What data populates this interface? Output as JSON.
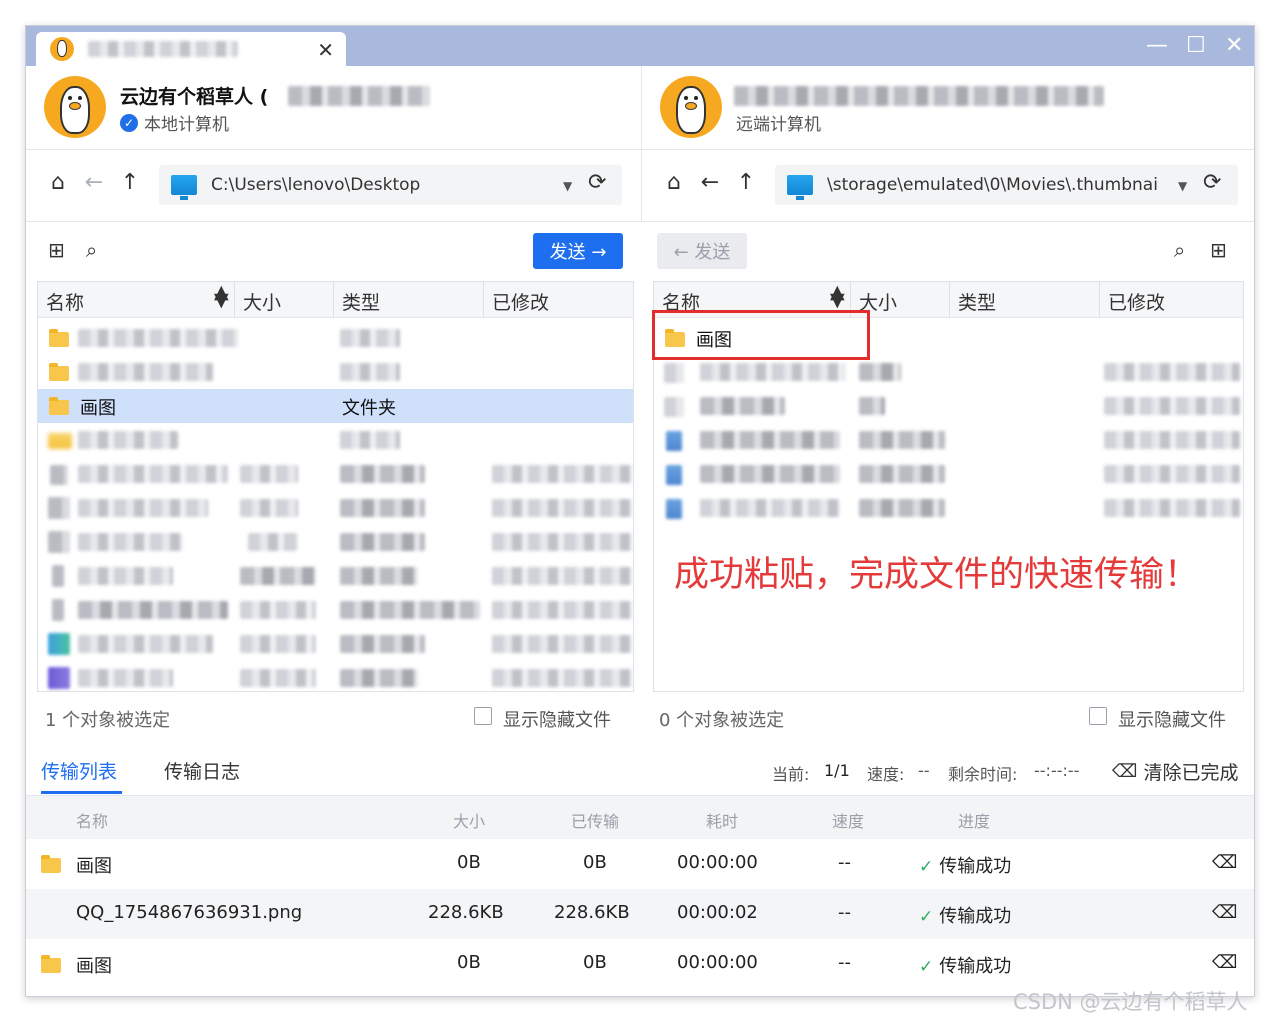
{
  "window": {
    "tab_close": "✕",
    "minimize": "—",
    "maximize": "☐",
    "close": "✕"
  },
  "local": {
    "user_name": "云边有个稻草人 (",
    "label": "本地计算机",
    "path": "C:\\Users\\lenovo\\Desktop",
    "send_label": "发送 →",
    "columns": [
      "名称",
      "大小",
      "类型",
      "已修改"
    ],
    "selected_row": {
      "name": "画图",
      "type": "文件夹"
    },
    "status": "1 个对象被选定",
    "show_hidden": "显示隐藏文件"
  },
  "remote": {
    "label": "远端计算机",
    "path": "\\storage\\emulated\\0\\Movies\\.thumbnai",
    "send_label": "← 发送",
    "columns": [
      "名称",
      "大小",
      "类型",
      "已修改"
    ],
    "first_row": {
      "name": "画图"
    },
    "status": "0 个对象被选定",
    "show_hidden": "显示隐藏文件",
    "annotation": "成功粘贴，完成文件的快速传输！"
  },
  "transfer": {
    "tabs": [
      "传输列表",
      "传输日志"
    ],
    "current_label": "当前:",
    "current_value": "1/1",
    "speed_label": "速度:",
    "speed_value": "--",
    "remaining_label": "剩余时间:",
    "remaining_value": "--:--:--",
    "clear_label": "清除已完成",
    "columns": [
      "名称",
      "大小",
      "已传输",
      "耗时",
      "速度",
      "进度"
    ],
    "rows": [
      {
        "name": "画图",
        "size": "0B",
        "done": "0B",
        "time": "00:00:00",
        "speed": "--",
        "status": "传输成功"
      },
      {
        "name": "QQ_1754867636931.png",
        "size": "228.6KB",
        "done": "228.6KB",
        "time": "00:00:02",
        "speed": "--",
        "status": "传输成功"
      },
      {
        "name": "画图",
        "size": "0B",
        "done": "0B",
        "time": "00:00:00",
        "speed": "--",
        "status": "传输成功"
      }
    ]
  },
  "watermark": "CSDN @云边有个稻草人",
  "colors": {
    "accent": "#1e6ff0",
    "titlebar": "#a9b8dd",
    "annotation_red": "#e43a3a",
    "success": "#2eae5f"
  }
}
